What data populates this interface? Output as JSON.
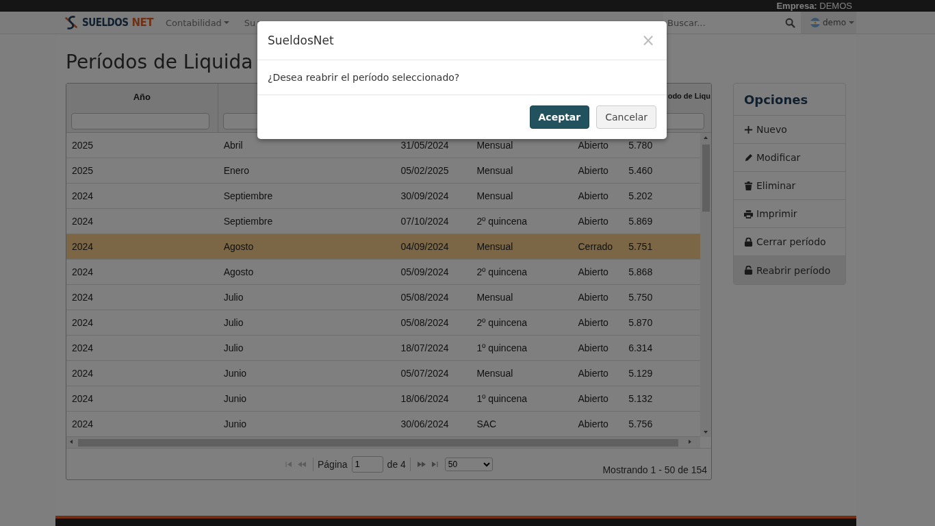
{
  "top_bar": {
    "company": "**Empresa:** DEMOS"
  },
  "navbar": {
    "brand": [
      "SUELDOS",
      "NET"
    ],
    "menu": [
      {
        "label": "Contabilidad"
      },
      {
        "label": "Su"
      }
    ],
    "search": {
      "placeholder": "Buscar..."
    },
    "user": {
      "label": "demo"
    }
  },
  "page": {
    "title": "Períodos de Liquida"
  },
  "table": {
    "columns": [
      {
        "label": "Año"
      },
      {},
      {
        "label": "odo de Liqu"
      }
    ],
    "rows": [
      {
        "cells": [
          "2025",
          "Abril",
          "31/05/2024",
          "Mensual",
          "Abierto",
          "5.780"
        ],
        "selected": false
      },
      {
        "cells": [
          "2025",
          "Enero",
          "05/02/2025",
          "Mensual",
          "Abierto",
          "5.460"
        ],
        "selected": false
      },
      {
        "cells": [
          "2024",
          "Septiembre",
          "30/09/2024",
          "Mensual",
          "Abierto",
          "5.202"
        ],
        "selected": false
      },
      {
        "cells": [
          "2024",
          "Septiembre",
          "07/10/2024",
          "2º quincena",
          "Abierto",
          "5.869"
        ],
        "selected": false
      },
      {
        "cells": [
          "2024",
          "Agosto",
          "04/09/2024",
          "Mensual",
          "Cerrado",
          "5.751"
        ],
        "selected": true
      },
      {
        "cells": [
          "2024",
          "Agosto",
          "05/09/2024",
          "2º quincena",
          "Abierto",
          "5.868"
        ],
        "selected": false
      },
      {
        "cells": [
          "2024",
          "Julio",
          "05/08/2024",
          "Mensual",
          "Abierto",
          "5.750"
        ],
        "selected": false
      },
      {
        "cells": [
          "2024",
          "Julio",
          "05/08/2024",
          "2º quincena",
          "Abierto",
          "5.870"
        ],
        "selected": false
      },
      {
        "cells": [
          "2024",
          "Julio",
          "18/07/2024",
          "1º quincena",
          "Abierto",
          "6.314"
        ],
        "selected": false
      },
      {
        "cells": [
          "2024",
          "Junio",
          "05/07/2024",
          "Mensual",
          "Abierto",
          "5.129"
        ],
        "selected": false
      },
      {
        "cells": [
          "2024",
          "Junio",
          "18/06/2024",
          "1º quincena",
          "Abierto",
          "5.132"
        ],
        "selected": false
      },
      {
        "cells": [
          "2024",
          "Junio",
          "30/06/2024",
          "SAC",
          "Abierto",
          "5.756"
        ],
        "selected": false
      }
    ],
    "pager": {
      "page_label": "Página",
      "page": "1",
      "of": "de 4",
      "page_size": "50",
      "summary": "Mostrando 1 - 50 de 154"
    }
  },
  "options": {
    "title": "Opciones",
    "items": [
      {
        "label": "Nuevo",
        "kind": "plus",
        "selected": false
      },
      {
        "label": "Modificar",
        "kind": "pencil",
        "selected": false
      },
      {
        "label": "Eliminar",
        "kind": "trash",
        "selected": false
      },
      {
        "label": "Imprimir",
        "kind": "printer",
        "selected": false
      },
      {
        "label": "Cerrar período",
        "kind": "lock",
        "selected": false
      },
      {
        "label": "Reabrir período",
        "kind": "unlock",
        "selected": true
      }
    ]
  },
  "dialog": {
    "title": "SueldosNet",
    "close": "×",
    "message": "¿Desea reabrir el período seleccionado?",
    "buttons": [
      {
        "label": "Aceptar",
        "kind": "primary"
      },
      {
        "label": "Cancelar",
        "kind": "default"
      }
    ]
  }
}
